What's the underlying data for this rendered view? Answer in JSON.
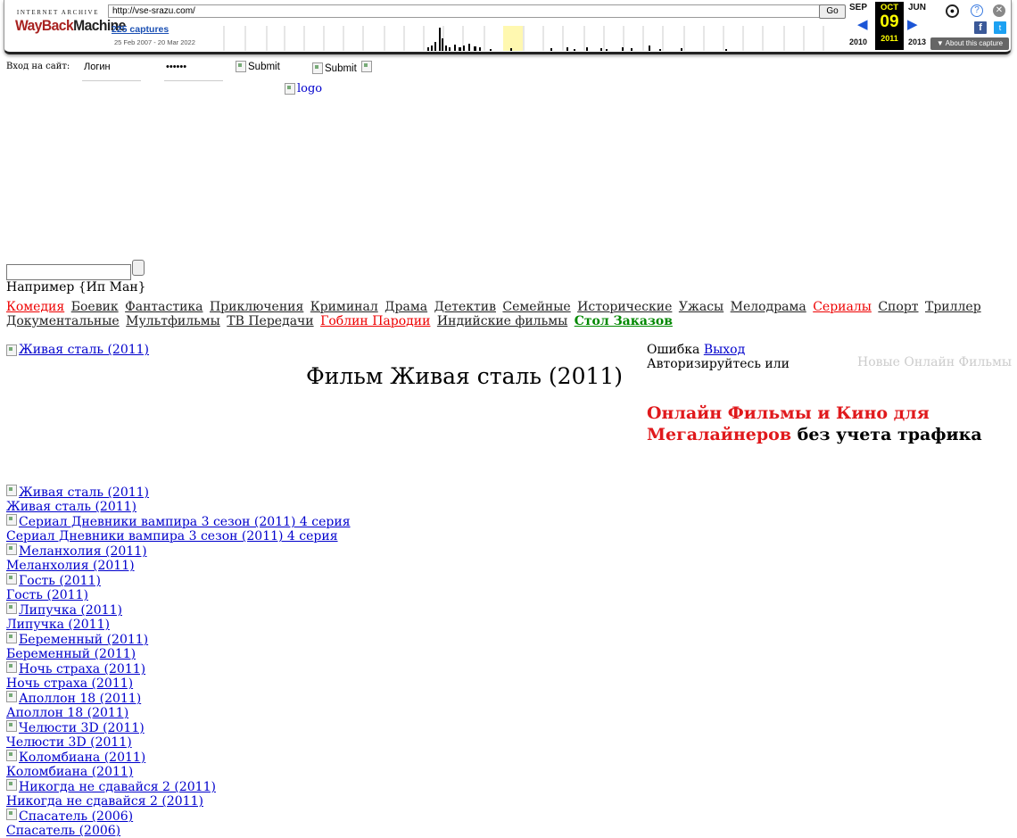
{
  "wayback": {
    "ia_label": "INTERNET ARCHIVE",
    "logo_way": "WayBack",
    "logo_machine": "Machine",
    "url": "http://vse-srazu.com/",
    "go_label": "Go",
    "captures": "225 captures",
    "range": "25 Feb 2007 - 20 Mar 2022",
    "prev_month": "SEP",
    "cur_month": "OCT",
    "next_month": "JUN",
    "prev_year": "2010",
    "cur_day": "09",
    "cur_year": "2011",
    "next_year": "2013",
    "about": "About this capture",
    "colors": {
      "accent": "#1b55d6",
      "current_bg": "#000000",
      "current_fg": "#ffff00",
      "logo_red": "#a82220"
    }
  },
  "login": {
    "label": "Вход на сайт:",
    "login_value": "Логин",
    "password_value": "••••••",
    "submit1": "Submit",
    "submit2": "Submit"
  },
  "logo_alt": "logo",
  "search": {
    "example": "Например {Ип Ман}"
  },
  "genres": [
    {
      "label": "Комедия",
      "style": "red"
    },
    {
      "label": "Боевик",
      "style": "plain"
    },
    {
      "label": "Фантастика",
      "style": "plain"
    },
    {
      "label": "Приключения",
      "style": "plain"
    },
    {
      "label": "Криминал",
      "style": "plain"
    },
    {
      "label": "Драма",
      "style": "plain"
    },
    {
      "label": "Детектив",
      "style": "plain"
    },
    {
      "label": "Семейные",
      "style": "plain"
    },
    {
      "label": "Исторические",
      "style": "plain"
    },
    {
      "label": "Ужасы",
      "style": "plain"
    },
    {
      "label": "Мелодрама",
      "style": "plain"
    },
    {
      "label": "Сериалы",
      "style": "red"
    },
    {
      "label": "Спорт",
      "style": "plain"
    },
    {
      "label": "Триллер",
      "style": "plain"
    },
    {
      "label": "Документальные",
      "style": "plain"
    },
    {
      "label": "Мультфильмы",
      "style": "plain"
    },
    {
      "label": "ТВ Передачи",
      "style": "plain"
    },
    {
      "label": "Гоблин Пародии",
      "style": "red"
    },
    {
      "label": "Индийские фильмы",
      "style": "plain"
    },
    {
      "label": "Стол Заказов",
      "style": "green"
    }
  ],
  "hero": {
    "img_alt": "Живая сталь (2011)",
    "title": "Фильм Живая сталь (2011)"
  },
  "auth": {
    "error": "Ошибка",
    "logout": "Выход",
    "prompt": "Авторизируйтесь или",
    "new_films": "Новые Онлайн Фильмы"
  },
  "slogan": {
    "red": "Онлайн Фильмы и Кино для Мегалайнеров",
    "black": " без учета трафика"
  },
  "movies": [
    "Живая сталь (2011)",
    "Сериал Дневники вампира 3 сезон (2011) 4 серия",
    "Меланхолия (2011)",
    "Гость (2011)",
    "Липучка (2011)",
    "Беременный (2011)",
    "Ночь страха (2011)",
    "Аполлон 18 (2011)",
    "Челюсти 3D (2011)",
    "Коломбиана (2011)",
    "Никогда не сдавайся 2 (2011)",
    "Спасатель (2006)"
  ]
}
